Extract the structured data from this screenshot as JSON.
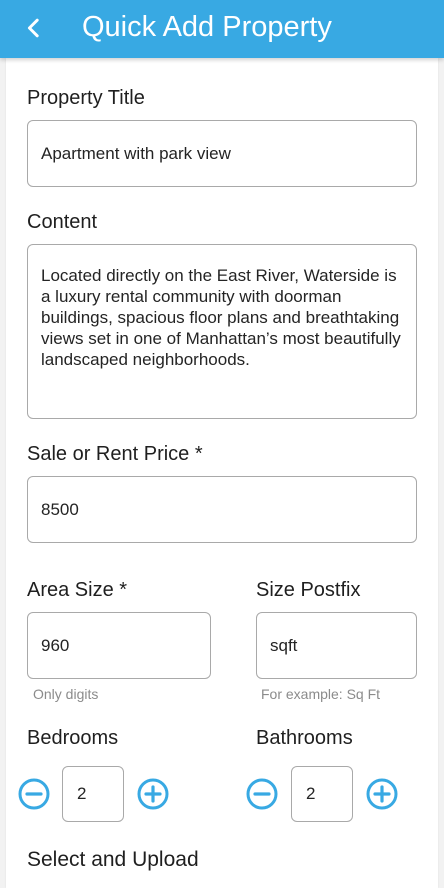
{
  "app_bar": {
    "title": "Quick Add Property",
    "back_icon": "back-arrow-icon",
    "color": "#38a9e3"
  },
  "form": {
    "property_title": {
      "label": "Property Title",
      "value": "Apartment with park view"
    },
    "content": {
      "label": "Content",
      "value": "Located directly on the East River, Waterside is a luxury rental community with doorman buildings, spacious floor plans and breathtaking views set in one of Manhattan’s most beautifully landscaped neighborhoods."
    },
    "price": {
      "label": "Sale or Rent Price *",
      "value": "8500"
    },
    "area_size": {
      "label": "Area Size *",
      "value": "960",
      "helper": "Only digits"
    },
    "size_postfix": {
      "label": "Size Postfix",
      "value": "sqft",
      "helper": "For example: Sq Ft"
    },
    "bedrooms": {
      "label": "Bedrooms",
      "value": "2",
      "minus_icon": "minus-circle-icon",
      "plus_icon": "plus-circle-icon"
    },
    "bathrooms": {
      "label": "Bathrooms",
      "value": "2",
      "minus_icon": "minus-circle-icon",
      "plus_icon": "plus-circle-icon"
    },
    "upload_section_title": "Select and Upload"
  },
  "colors": {
    "accent": "#38a9e3",
    "border": "#a9a9a9",
    "helper_text": "#8b8b8b"
  }
}
